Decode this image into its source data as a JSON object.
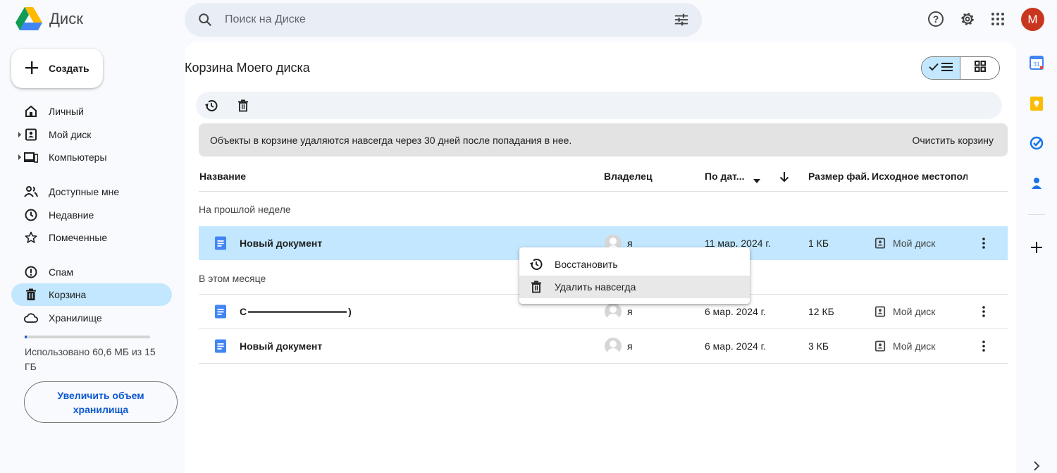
{
  "app": {
    "title": "Диск"
  },
  "search": {
    "placeholder": "Поиск на Диске"
  },
  "user": {
    "avatar_letter": "M",
    "avatar_color": "#c9361f"
  },
  "sidebar": {
    "create_label": "Создать",
    "items": [
      {
        "label": "Личный",
        "icon": "home-icon"
      },
      {
        "label": "Мой диск",
        "icon": "my-drive-icon"
      },
      {
        "label": "Компьютеры",
        "icon": "computers-icon"
      },
      {
        "label": "Доступные мне",
        "icon": "shared-icon"
      },
      {
        "label": "Недавние",
        "icon": "clock-icon"
      },
      {
        "label": "Помеченные",
        "icon": "star-icon"
      },
      {
        "label": "Спам",
        "icon": "spam-icon"
      },
      {
        "label": "Корзина",
        "icon": "trash-icon",
        "active": true
      },
      {
        "label": "Хранилище",
        "icon": "cloud-icon"
      }
    ],
    "storage_text": "Использовано 60,6 МБ из 15 ГБ",
    "storage_used_fraction": 0.004,
    "upgrade_label": "Увеличить объем хранилища"
  },
  "main": {
    "title": "Корзина Моего диска",
    "banner_text": "Объекты в корзине удаляются навсегда через 30 дней после попадания в нее.",
    "clear_trash_label": "Очистить корзину",
    "columns": {
      "name": "Название",
      "owner": "Владелец",
      "date": "По дат...",
      "size": "Размер фай.",
      "location": "Исходное местопол"
    },
    "groups": [
      {
        "label": "На прошлой неделе",
        "rows": [
          {
            "name": "Новый документ",
            "owner": "я",
            "date": "11 мар. 2024 г.",
            "size": "1 КБ",
            "location": "Мой диск",
            "selected": true
          }
        ]
      },
      {
        "label": "В этом месяце",
        "rows": [
          {
            "name_prefix": "С",
            "name_suffix": ")",
            "owner": "я",
            "date": "6 мар. 2024 г.",
            "size": "12 КБ",
            "location": "Мой диск"
          },
          {
            "name": "Новый документ",
            "owner": "я",
            "date": "6 мар. 2024 г.",
            "size": "3 КБ",
            "location": "Мой диск"
          }
        ]
      }
    ]
  },
  "context_menu": {
    "restore_label": "Восстановить",
    "delete_label": "Удалить навсегда"
  },
  "colors": {
    "accent": "#0b57d0",
    "selected_bg": "#c2e7ff",
    "doc_blue": "#4285f4"
  }
}
